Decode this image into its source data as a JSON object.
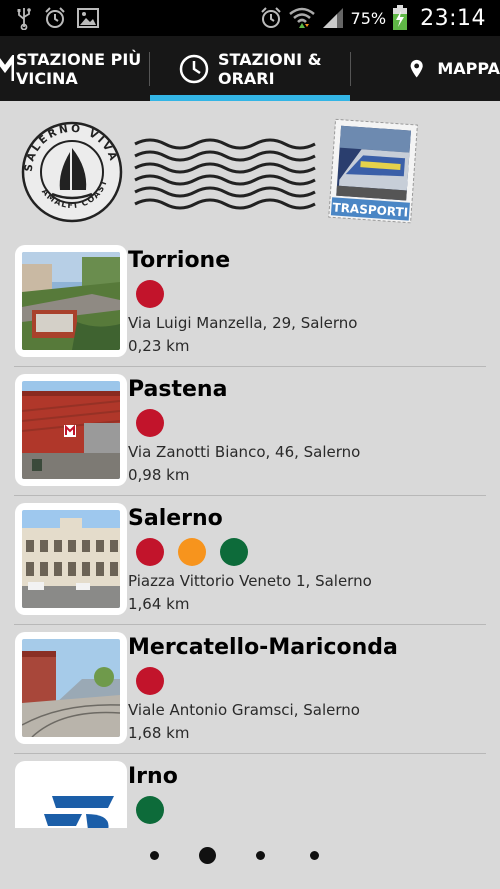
{
  "status_bar": {
    "icons": [
      "usb-icon",
      "alarm-icon",
      "gallery-icon",
      "alarm-clock-icon",
      "wifi-icon",
      "signal-icon",
      "battery-charging-icon"
    ],
    "battery_percent": "75%",
    "time": "23:14"
  },
  "tabs": [
    {
      "label": "STAZIONE PIÙ\nVICINA",
      "icon": "metro-icon",
      "selected": false
    },
    {
      "label": "STAZIONI &\nORARI",
      "icon": "clock-icon",
      "selected": true
    },
    {
      "label": "MAPPA",
      "icon": "map-pin-icon",
      "selected": false
    }
  ],
  "banner": {
    "logo_text": "SALERNO VIVA",
    "logo_subtext": "AMALFI COAST",
    "stamp_label": "TRASPORTI"
  },
  "line_colors": {
    "red": "#c2142b",
    "orange": "#f7941d",
    "green": "#0d6b3a"
  },
  "stations": [
    {
      "name": "Torrione",
      "lines": [
        "red"
      ],
      "address": "Via Luigi Manzella, 29, Salerno",
      "distance": "0,23 km",
      "thumb": "torrione-photo"
    },
    {
      "name": "Pastena",
      "lines": [
        "red"
      ],
      "address": "Via Zanotti Bianco, 46, Salerno",
      "distance": "0,98 km",
      "thumb": "pastena-photo"
    },
    {
      "name": "Salerno",
      "lines": [
        "red",
        "orange",
        "green"
      ],
      "address": "Piazza Vittorio Veneto 1, Salerno",
      "distance": "1,64 km",
      "thumb": "salerno-photo"
    },
    {
      "name": "Mercatello-Mariconda",
      "lines": [
        "red"
      ],
      "address": "Viale Antonio Gramsci, Salerno",
      "distance": "1,68 km",
      "thumb": "mercatello-photo"
    },
    {
      "name": "Irno",
      "lines": [
        "green"
      ],
      "address": "",
      "distance": "",
      "thumb": "fs-logo"
    }
  ],
  "pager": {
    "count": 4,
    "active_index": 1
  }
}
